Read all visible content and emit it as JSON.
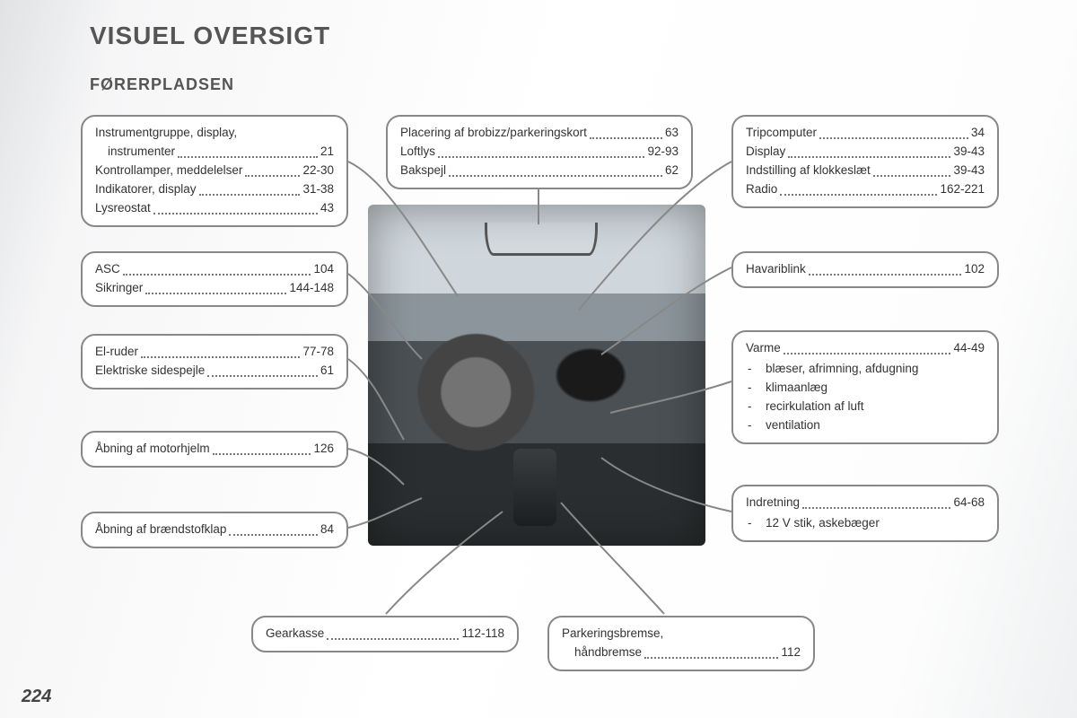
{
  "title": "VISUEL OVERSIGT",
  "subtitle": "FØRERPLADSEN",
  "page_number": "224",
  "callouts": {
    "b1": [
      {
        "label": "Instrumentgruppe, display,",
        "page": ""
      },
      {
        "label": "instrumenter",
        "page": "21",
        "indent": true
      },
      {
        "label": "Kontrollamper, meddelelser",
        "page": "22-30"
      },
      {
        "label": "Indikatorer, display",
        "page": "31-38"
      },
      {
        "label": "Lysreostat",
        "page": "43"
      }
    ],
    "b2": [
      {
        "label": "ASC",
        "page": "104"
      },
      {
        "label": "Sikringer",
        "page": "144-148"
      }
    ],
    "b3": [
      {
        "label": "El-ruder",
        "page": "77-78"
      },
      {
        "label": "Elektriske sidespejle",
        "page": "61"
      }
    ],
    "b4": [
      {
        "label": "Åbning af motorhjelm",
        "page": "126"
      }
    ],
    "b5": [
      {
        "label": "Åbning af brændstofklap",
        "page": "84"
      }
    ],
    "b6": [
      {
        "label": "Placering af brobizz/parkeringskort",
        "page": "63"
      },
      {
        "label": "Loftlys",
        "page": "92-93"
      },
      {
        "label": "Bakspejl",
        "page": "62"
      }
    ],
    "b7": [
      {
        "label": "Tripcomputer",
        "page": "34"
      },
      {
        "label": "Display",
        "page": "39-43"
      },
      {
        "label": "Indstilling af klokkeslæt",
        "page": "39-43"
      },
      {
        "label": "Radio",
        "page": "162-221"
      }
    ],
    "b8": [
      {
        "label": "Havariblink",
        "page": "102"
      }
    ],
    "b9": {
      "rows": [
        {
          "label": "Varme",
          "page": "44-49"
        }
      ],
      "bullets": [
        "blæser, afrimning, afdugning",
        "klimaanlæg",
        "recirkulation af luft",
        "ventilation"
      ]
    },
    "b10": {
      "rows": [
        {
          "label": "Indretning",
          "page": "64-68"
        }
      ],
      "bullets": [
        "12 V stik, askebæger"
      ]
    },
    "b11": [
      {
        "label": "Gearkasse",
        "page": "112-118"
      }
    ],
    "b12": [
      {
        "label": "Parkeringsbremse,",
        "page": ""
      },
      {
        "label": "håndbremse",
        "page": "112",
        "indent": true
      }
    ]
  }
}
